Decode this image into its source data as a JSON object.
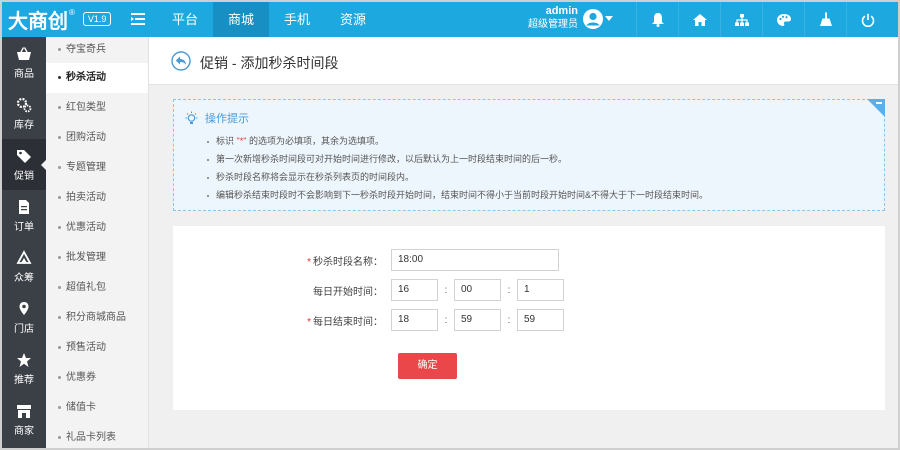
{
  "app": {
    "logo_text": "大商创",
    "logo_mark": "®",
    "version": "V1.9"
  },
  "topnav": [
    {
      "label": "平台",
      "active": false
    },
    {
      "label": "商城",
      "active": true
    },
    {
      "label": "手机",
      "active": false
    },
    {
      "label": "资源",
      "active": false
    }
  ],
  "user": {
    "name": "admin",
    "role": "超级管理员"
  },
  "top_icons": [
    "bell-icon",
    "home-icon",
    "sitemap-icon",
    "palette-icon",
    "broom-icon",
    "power-icon"
  ],
  "sidebar_main": [
    {
      "label": "商品",
      "icon": "basket-icon"
    },
    {
      "label": "库存",
      "icon": "gears-icon"
    },
    {
      "label": "促销",
      "icon": "tags-icon",
      "active": true
    },
    {
      "label": "订单",
      "icon": "order-icon"
    },
    {
      "label": "众筹",
      "icon": "crowdfund-icon"
    },
    {
      "label": "门店",
      "icon": "location-icon"
    },
    {
      "label": "推荐",
      "icon": "star-icon"
    },
    {
      "label": "商家",
      "icon": "store-icon"
    }
  ],
  "sidebar_sub": [
    {
      "label": "夺宝奇兵"
    },
    {
      "label": "秒杀活动",
      "active": true
    },
    {
      "label": "红包类型"
    },
    {
      "label": "团购活动"
    },
    {
      "label": "专题管理"
    },
    {
      "label": "拍卖活动"
    },
    {
      "label": "优惠活动"
    },
    {
      "label": "批发管理"
    },
    {
      "label": "超值礼包"
    },
    {
      "label": "积分商城商品"
    },
    {
      "label": "预售活动"
    },
    {
      "label": "优惠券"
    },
    {
      "label": "储值卡"
    },
    {
      "label": "礼品卡列表"
    }
  ],
  "page": {
    "title": "促销 - 添加秒杀时间段"
  },
  "tips": {
    "title": "操作提示",
    "items": [
      {
        "pre": "标识",
        "mark": "\"*\"",
        "post": "的选项为必填项，其余为选填项。"
      },
      {
        "pre": "第一次新增秒杀时间段可对开始时间进行修改，以后默认为上一时段结束时间的后一秒。",
        "mark": "",
        "post": ""
      },
      {
        "pre": "秒杀时段名称将会显示在秒杀列表页的时间段内。",
        "mark": "",
        "post": ""
      },
      {
        "pre": "编辑秒杀结束时段时不会影响到下一秒杀时段开始时间，结束时间不得小于当前时段开始时间&不得大于下一时段结束时间。",
        "mark": "",
        "post": ""
      }
    ]
  },
  "form": {
    "name_label": "秒杀时段名称：",
    "name_value": "18:00",
    "start_label": "每日开始时间：",
    "start_h": "16",
    "start_m": "00",
    "start_s": "1",
    "end_label": "每日结束时间：",
    "end_h": "18",
    "end_m": "59",
    "end_s": "59",
    "colon": ":",
    "required_mark": "*",
    "submit_label": "确定"
  },
  "colors": {
    "topbar": "#1ea8e0",
    "sidebar": "#3b3f46",
    "submit": "#e9474a",
    "required": "#e0312e"
  }
}
